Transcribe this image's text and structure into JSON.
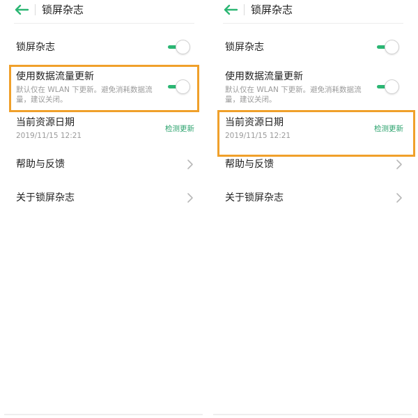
{
  "left": {
    "header": {
      "title": "锁屏杂志"
    },
    "items": [
      {
        "label": "锁屏杂志",
        "toggle_on": true
      },
      {
        "label": "使用数据流量更新",
        "desc": "默认仅在 WLAN 下更新。避免消耗数据流量，建议关闭。",
        "toggle_on": true
      },
      {
        "label": "当前资源日期",
        "date": "2019/11/15 12:21",
        "action": "检测更新"
      },
      {
        "label": "帮助与反馈",
        "icon": "chevron-right-icon"
      },
      {
        "label": "关于锁屏杂志",
        "icon": "chevron-right-icon"
      }
    ],
    "highlighted_item": "使用数据流量更新"
  },
  "right": {
    "header": {
      "title": "锁屏杂志"
    },
    "items": [
      {
        "label": "锁屏杂志",
        "toggle_on": true
      },
      {
        "label": "使用数据流量更新",
        "desc": "默认仅在 WLAN 下更新。避免消耗数据流量，建议关闭。",
        "toggle_on": true
      },
      {
        "label": "当前资源日期",
        "date": "2019/11/15 12:21",
        "action": "检测更新"
      },
      {
        "label": "帮助与反馈",
        "icon": "chevron-right-icon"
      },
      {
        "label": "关于锁屏杂志",
        "icon": "chevron-right-icon"
      }
    ],
    "highlighted_item": "当前资源日期"
  },
  "colors": {
    "accent": "#2bb673",
    "link": "#2aa26c",
    "highlight": "#f0a02a",
    "secondary_text": "#9a9a9a"
  }
}
